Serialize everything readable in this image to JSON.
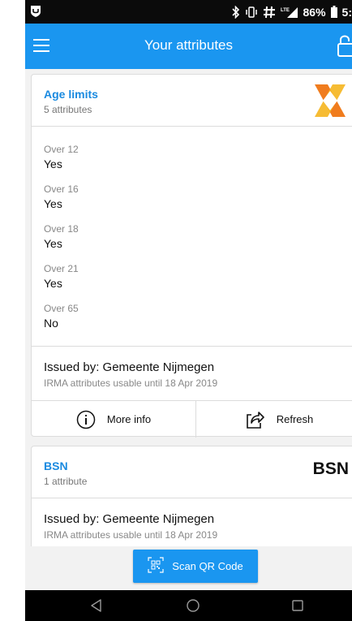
{
  "status_bar": {
    "battery": "86%",
    "time_fragment": "5:"
  },
  "app_bar": {
    "title": "Your attributes"
  },
  "cards": [
    {
      "title": "Age limits",
      "subtitle": "5 attributes",
      "attributes": [
        {
          "label": "Over 12",
          "value": "Yes"
        },
        {
          "label": "Over 16",
          "value": "Yes"
        },
        {
          "label": "Over 18",
          "value": "Yes"
        },
        {
          "label": "Over 21",
          "value": "Yes"
        },
        {
          "label": "Over 65",
          "value": "No"
        }
      ],
      "issued_by": "Issued by: Gemeente Nijmegen",
      "usable_until": "IRMA attributes usable until 18 Apr 2019",
      "more_info_label": "More info",
      "refresh_label": "Refresh"
    },
    {
      "title": "BSN",
      "subtitle": "1 attribute",
      "logo_text": "BSN",
      "issued_by": "Issued by: Gemeente Nijmegen",
      "usable_until": "IRMA attributes usable until 18 Apr 2019"
    }
  ],
  "scan_button": {
    "label": "Scan QR Code"
  },
  "colors": {
    "primary": "#1a96f0",
    "title_blue": "#1a8ae0",
    "logo_orange": "#f07c1e",
    "logo_yellow": "#f5b51e"
  },
  "icons": [
    "menu-icon",
    "lock-icon",
    "info-icon",
    "share-icon",
    "qr-icon",
    "back-icon",
    "home-icon",
    "recent-apps-icon"
  ]
}
